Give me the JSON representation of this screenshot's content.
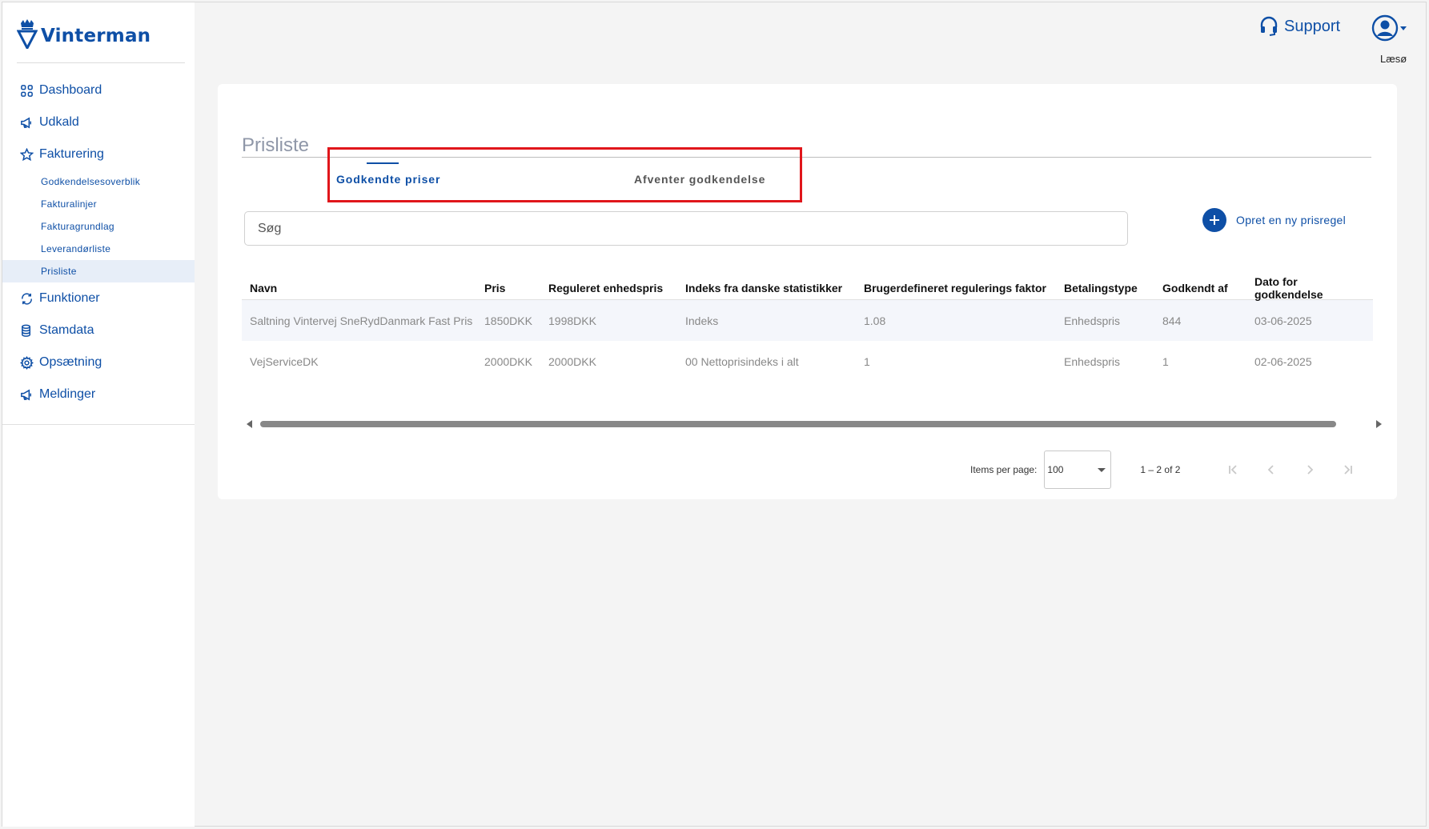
{
  "brand": {
    "name": "Vinterman",
    "color": "#0e4fa6"
  },
  "sidebar": {
    "items": [
      {
        "label": "Dashboard",
        "icon": "grid-icon"
      },
      {
        "label": "Udkald",
        "icon": "megaphone-icon"
      },
      {
        "label": "Fakturering",
        "icon": "star-icon"
      }
    ],
    "subitems": [
      {
        "label": "Godkendelsesoverblik"
      },
      {
        "label": "Fakturalinjer"
      },
      {
        "label": "Fakturagrundlag"
      },
      {
        "label": "Leverandørliste"
      },
      {
        "label": "Prisliste",
        "active": true
      }
    ],
    "items_after": [
      {
        "label": "Funktioner",
        "icon": "refresh-icon"
      },
      {
        "label": "Stamdata",
        "icon": "database-icon"
      },
      {
        "label": "Opsætning",
        "icon": "gear-icon"
      },
      {
        "label": "Meldinger",
        "icon": "megaphone-icon"
      }
    ]
  },
  "header": {
    "support_label": "Support",
    "user_name": "Læsø"
  },
  "main": {
    "title": "Prisliste",
    "tabs": [
      {
        "label": "Godkendte priser",
        "active": true
      },
      {
        "label": "Afventer godkendelse",
        "active": false
      }
    ],
    "search": {
      "placeholder": "Søg",
      "value": ""
    },
    "add_button_label": "Opret en ny prisregel",
    "table": {
      "columns": [
        "Navn",
        "Pris",
        "Reguleret enhedspris",
        "Indeks fra danske statistikker",
        "Brugerdefineret regulerings faktor",
        "Betalingstype",
        "Godkendt af",
        "Dato for godkendelse"
      ],
      "rows": [
        [
          "Saltning Vintervej SneRydDanmark Fast Pris",
          "1850DKK",
          "1998DKK",
          "Indeks",
          "1.08",
          "Enhedspris",
          "844",
          "03-06-2025"
        ],
        [
          "VejServiceDK",
          "2000DKK",
          "2000DKK",
          "00 Nettoprisindeks i alt",
          "1",
          "Enhedspris",
          "1",
          "02-06-2025"
        ]
      ]
    },
    "paginator": {
      "items_per_page_label": "Items per page:",
      "items_per_page_value": "100",
      "range_label": "1 – 2 of 2"
    }
  }
}
